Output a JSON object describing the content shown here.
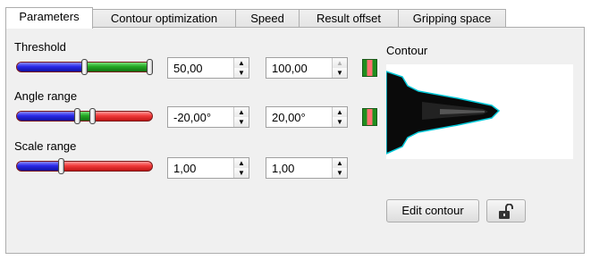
{
  "tabs": [
    {
      "label": "Parameters",
      "active": true
    },
    {
      "label": "Contour optimization",
      "active": false
    },
    {
      "label": "Speed",
      "active": false
    },
    {
      "label": "Result offset",
      "active": false
    },
    {
      "label": "Gripping space",
      "active": false
    }
  ],
  "parameters": {
    "threshold": {
      "label": "Threshold",
      "min_value": "50,00",
      "max_value": "100,00",
      "slider_low": 0.5,
      "slider_high": 1.0
    },
    "angle_range": {
      "label": "Angle range",
      "min_value": "-20,00°",
      "max_value": "20,00°",
      "slider_low": 0.44,
      "slider_high": 0.56
    },
    "scale_range": {
      "label": "Scale range",
      "min_value": "1,00",
      "max_value": "1,00",
      "slider_value": 0.33
    }
  },
  "contour": {
    "label": "Contour",
    "edit_button": "Edit contour"
  },
  "icons": {
    "spin_up": "up-arrow-icon",
    "spin_down": "down-arrow-icon",
    "lock": "unlocked-padlock-icon",
    "status_led": "green-red-led-icon"
  },
  "colors": {
    "slider_blue": "#2a2ae8",
    "slider_green": "#23a823",
    "slider_red": "#e03030",
    "contour_edge": "#00c8d8"
  }
}
